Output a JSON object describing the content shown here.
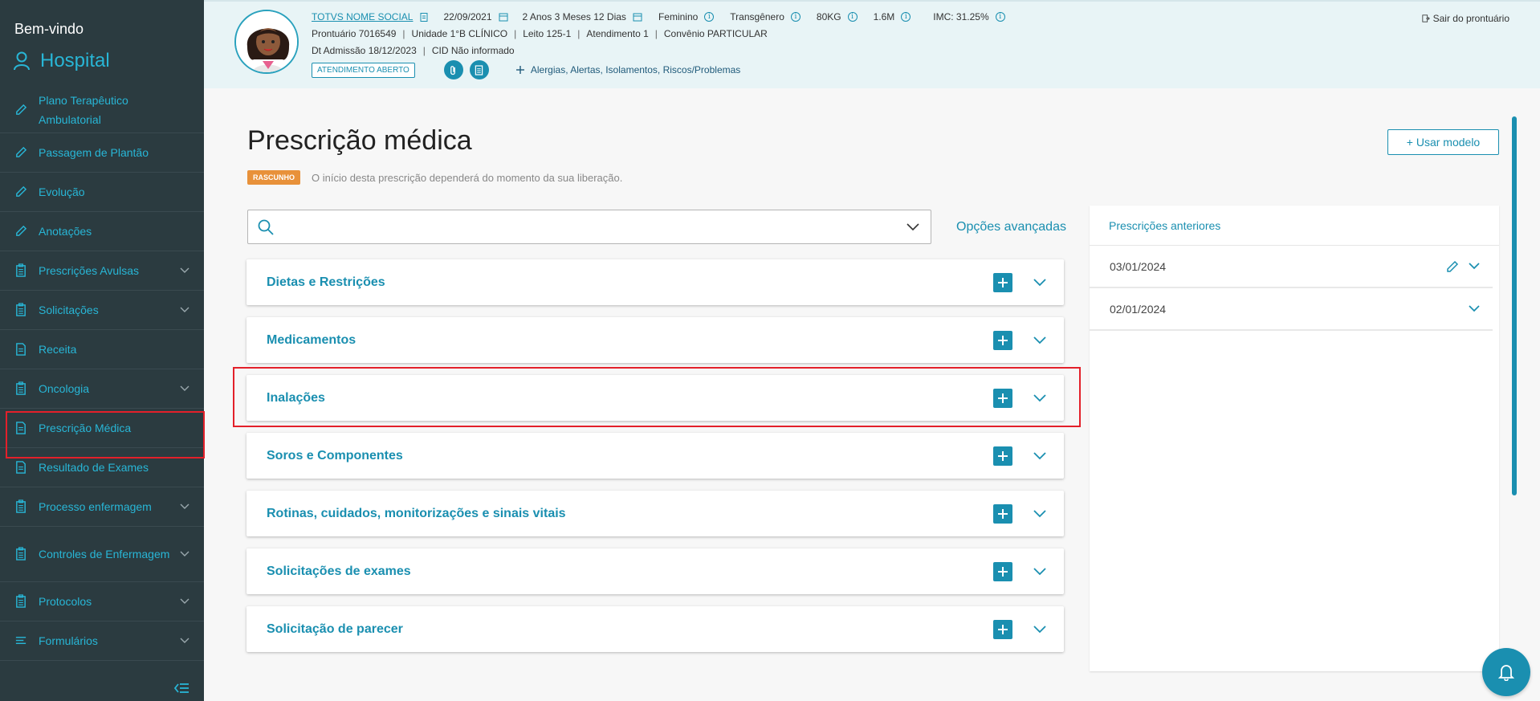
{
  "sidebar": {
    "welcome": "Bem-vindo",
    "hospital": "Hospital",
    "items": [
      {
        "label": "Plano Terapêutico Ambulatorial",
        "icon": "pencil-icon",
        "chevron": false
      },
      {
        "label": "Passagem de Plantão",
        "icon": "pencil-icon",
        "chevron": false
      },
      {
        "label": "Evolução",
        "icon": "pencil-icon",
        "chevron": false
      },
      {
        "label": "Anotações",
        "icon": "pencil-icon",
        "chevron": false
      },
      {
        "label": "Prescrições Avulsas",
        "icon": "clipboard-icon",
        "chevron": true
      },
      {
        "label": "Solicitações",
        "icon": "clipboard-icon",
        "chevron": true
      },
      {
        "label": "Receita",
        "icon": "document-icon",
        "chevron": false
      },
      {
        "label": "Oncologia",
        "icon": "clipboard-icon",
        "chevron": true
      },
      {
        "label": "Prescrição Médica",
        "icon": "document-icon",
        "chevron": false,
        "active": true
      },
      {
        "label": "Resultado de Exames",
        "icon": "document-icon",
        "chevron": false
      },
      {
        "label": "Processo enfermagem",
        "icon": "clipboard-icon",
        "chevron": true
      },
      {
        "label": "Controles de Enfermagem",
        "icon": "clipboard-icon",
        "chevron": true
      },
      {
        "label": "Protocolos",
        "icon": "clipboard-icon",
        "chevron": true
      },
      {
        "label": "Formulários",
        "icon": "list-icon",
        "chevron": true
      }
    ]
  },
  "patient": {
    "name": "TOTVS NOME SOCIAL",
    "birth_date": "22/09/2021",
    "age": "2 Anos 3 Meses 12 Dias",
    "sex": "Feminino",
    "gender": "Transgênero",
    "weight": "80KG",
    "height": "1.6M",
    "imc": "IMC: 31.25%",
    "prontuario": "Prontuário 7016549",
    "unidade": "Unidade 1°B CLÍNICO",
    "leito": "Leito 125-1",
    "atendimento": "Atendimento 1",
    "convenio": "Convênio PARTICULAR",
    "admissao": "Dt Admissão 18/12/2023",
    "cid": "CID Não informado",
    "status_badge": "ATENDIMENTO ABERTO",
    "alerts_link": "Alergias, Alertas, Isolamentos, Riscos/Problemas",
    "logout": "Sair do prontuário"
  },
  "main": {
    "title": "Prescrição médica",
    "status_badge": "RASCUNHO",
    "status_text": "O início desta prescrição dependerá do momento da sua liberação.",
    "use_model_button": "+ Usar modelo",
    "search_placeholder": "",
    "advanced_options": "Opções avançadas",
    "sections": [
      "Dietas e Restrições",
      "Medicamentos",
      "Inalações",
      "Soros e Componentes",
      "Rotinas, cuidados, monitorizações e sinais vitais",
      "Solicitações de exames",
      "Solicitação de parecer"
    ]
  },
  "previous": {
    "title": "Prescrições anteriores",
    "items": [
      {
        "date": "03/01/2024",
        "editable": true
      },
      {
        "date": "02/01/2024",
        "editable": false
      }
    ]
  },
  "colors": {
    "accent": "#1a8fb0",
    "sidebar_bg": "#2b3b40",
    "header_bg": "#e8f4f6",
    "draft": "#e8913a",
    "highlight": "#e3202a"
  }
}
